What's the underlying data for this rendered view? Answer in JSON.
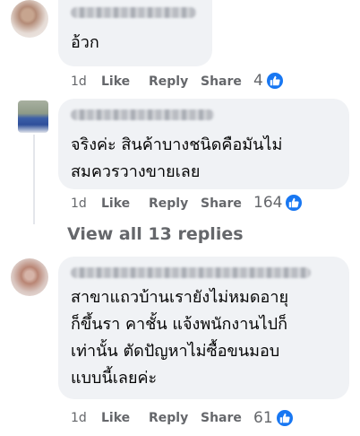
{
  "comments": [
    {
      "text": "อ้วก",
      "time": "1d",
      "like_label": "Like",
      "reply_label": "Reply",
      "share_label": "Share",
      "reaction_count": "4"
    },
    {
      "text": "จริงค่ะ สินค้าบางชนิดคือมันไม่\nสมควรวางขายเลย",
      "time": "1d",
      "like_label": "Like",
      "reply_label": "Reply",
      "share_label": "Share",
      "reaction_count": "164"
    },
    {
      "text": "สาขาแถวบ้านเรายังไม่หมดอายุ\nก็ขึ้นรา คาชั้น แจ้งพนักงานไปก็\nเท่านั้น ตัดปัญหาไม่ซื้อขนมอบ\nแบบนี้เลยค่ะ",
      "time": "1d",
      "like_label": "Like",
      "reply_label": "Reply",
      "share_label": "Share",
      "reaction_count": "61"
    }
  ],
  "view_replies_label": "View all 13 replies",
  "colors": {
    "bubble": "#f0f2f5",
    "meta_text": "#65676b",
    "like_blue": "#1877f2"
  },
  "icons": {
    "reaction": "like-thumb-icon"
  }
}
